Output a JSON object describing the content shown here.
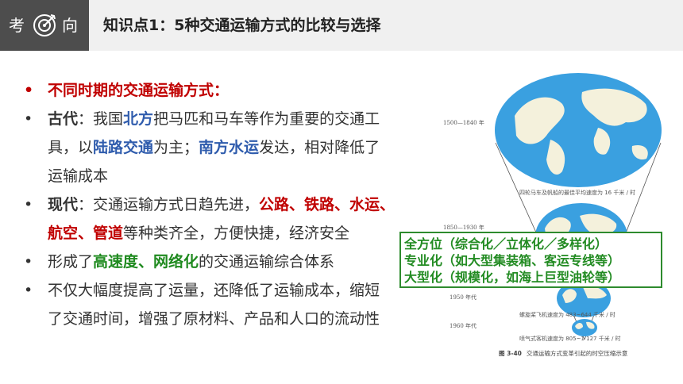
{
  "header": {
    "badge_left": "考",
    "badge_right": "向",
    "title": "知识点1：5种交通运输方式的比较与选择"
  },
  "colors": {
    "header_dark": "#4d4d4d",
    "header_light": "#f0f0f0",
    "red": "#c00000",
    "blue": "#2f5cad",
    "green": "#228b22",
    "ocean": "#3aa0e0",
    "land": "#f4f1dc"
  },
  "bullets": {
    "dot": "•",
    "b1": "不同时期的交通运输方式：",
    "b2": {
      "label": "古代",
      "colon": "：",
      "t1": "我国",
      "north": "北方",
      "t2": "把马匹和马车等作为重要的交通工",
      "t3": "具，以",
      "land_transport": "陆路交通",
      "t4": "为主；",
      "south_water": "南方水运",
      "t5": "发达，相对降低了",
      "t6": "运输成本"
    },
    "b3": {
      "label": "现代",
      "colon": "：",
      "t1": "交通运输方式日趋先进，",
      "modes1": "公路、铁路、水运、",
      "modes2": "航空、管道",
      "t2": "等种类齐全，方便快捷，经济安全"
    },
    "b4": {
      "t1": "形成了",
      "key": "高速度、网络化",
      "t2": "的交通运输综合体系"
    },
    "b5": {
      "t1": "不仅大幅度提高了运量，还降低了运输成本，缩短",
      "t2": "了交通时间，增强了原材料、产品和人口的流动性"
    }
  },
  "figure": {
    "era1": "1500—1840 年",
    "note1": "四轮马车及帆船的最佳平均速度为 16 千米 / 时",
    "era2": "1850—1930 年",
    "era3": "1950 年代",
    "note3": "螺旋桨飞机速度为 483~644 千米 / 时",
    "era4": "1960 年代",
    "note4": "喷气式客机速度为 805~1 127 千米 / 时",
    "caption_no": "图 3-40",
    "caption": "交通运输方式变革引起的时空压缩示意"
  },
  "summary": [
    "全方位（综合化／立体化／多样化）",
    "专业化（如大型集装箱、客运专线等）",
    "大型化（规模化，如海上巨型油轮等）"
  ]
}
